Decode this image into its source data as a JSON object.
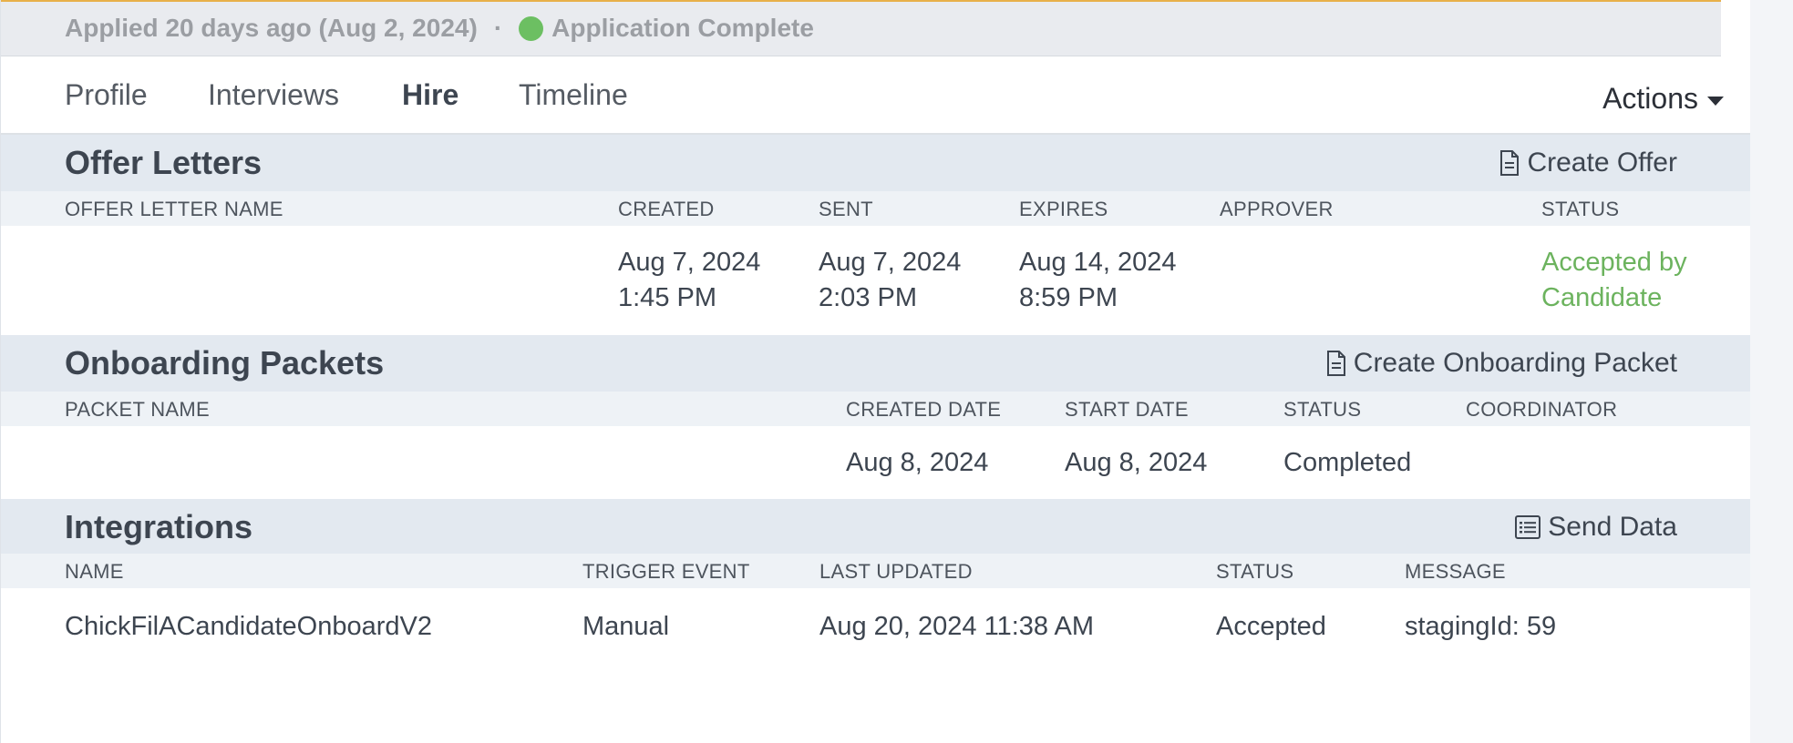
{
  "status": {
    "applied": "Applied 20 days ago (Aug 2, 2024)",
    "separator": "·",
    "application_state": "Application Complete",
    "dot_color": "#6cbf62"
  },
  "tabs": [
    {
      "label": "Profile"
    },
    {
      "label": "Interviews"
    },
    {
      "label": "Hire"
    },
    {
      "label": "Timeline"
    }
  ],
  "active_tab": "Hire",
  "actions_label": "Actions",
  "offer_letters": {
    "title": "Offer Letters",
    "action_label": "Create Offer",
    "action_icon": "document-icon",
    "columns": [
      "OFFER LETTER NAME",
      "CREATED",
      "SENT",
      "EXPIRES",
      "APPROVER",
      "STATUS"
    ],
    "rows": [
      {
        "name": "",
        "created_date": "Aug 7, 2024",
        "created_time": "1:45 PM",
        "sent_date": "Aug 7, 2024",
        "sent_time": "2:03 PM",
        "expires_date": "Aug 14, 2024",
        "expires_time": "8:59 PM",
        "approver": "",
        "status_line1": "Accepted by",
        "status_line2": "Candidate",
        "status_color": "#6cb35e"
      }
    ]
  },
  "onboarding_packets": {
    "title": "Onboarding Packets",
    "action_label": "Create Onboarding Packet",
    "action_icon": "document-icon",
    "columns": [
      "PACKET NAME",
      "CREATED DATE",
      "START DATE",
      "STATUS",
      "COORDINATOR"
    ],
    "rows": [
      {
        "name": "",
        "created_date": "Aug 8, 2024",
        "start_date": "Aug 8, 2024",
        "status": "Completed",
        "coordinator": ""
      }
    ]
  },
  "integrations": {
    "title": "Integrations",
    "action_label": "Send Data",
    "action_icon": "list-icon",
    "columns": [
      "NAME",
      "TRIGGER EVENT",
      "LAST UPDATED",
      "STATUS",
      "MESSAGE"
    ],
    "rows": [
      {
        "name": "ChickFilACandidateOnboardV2",
        "trigger_event": "Manual",
        "last_updated": "Aug 20, 2024 11:38 AM",
        "status": "Accepted",
        "message": "stagingId: 59"
      }
    ]
  }
}
